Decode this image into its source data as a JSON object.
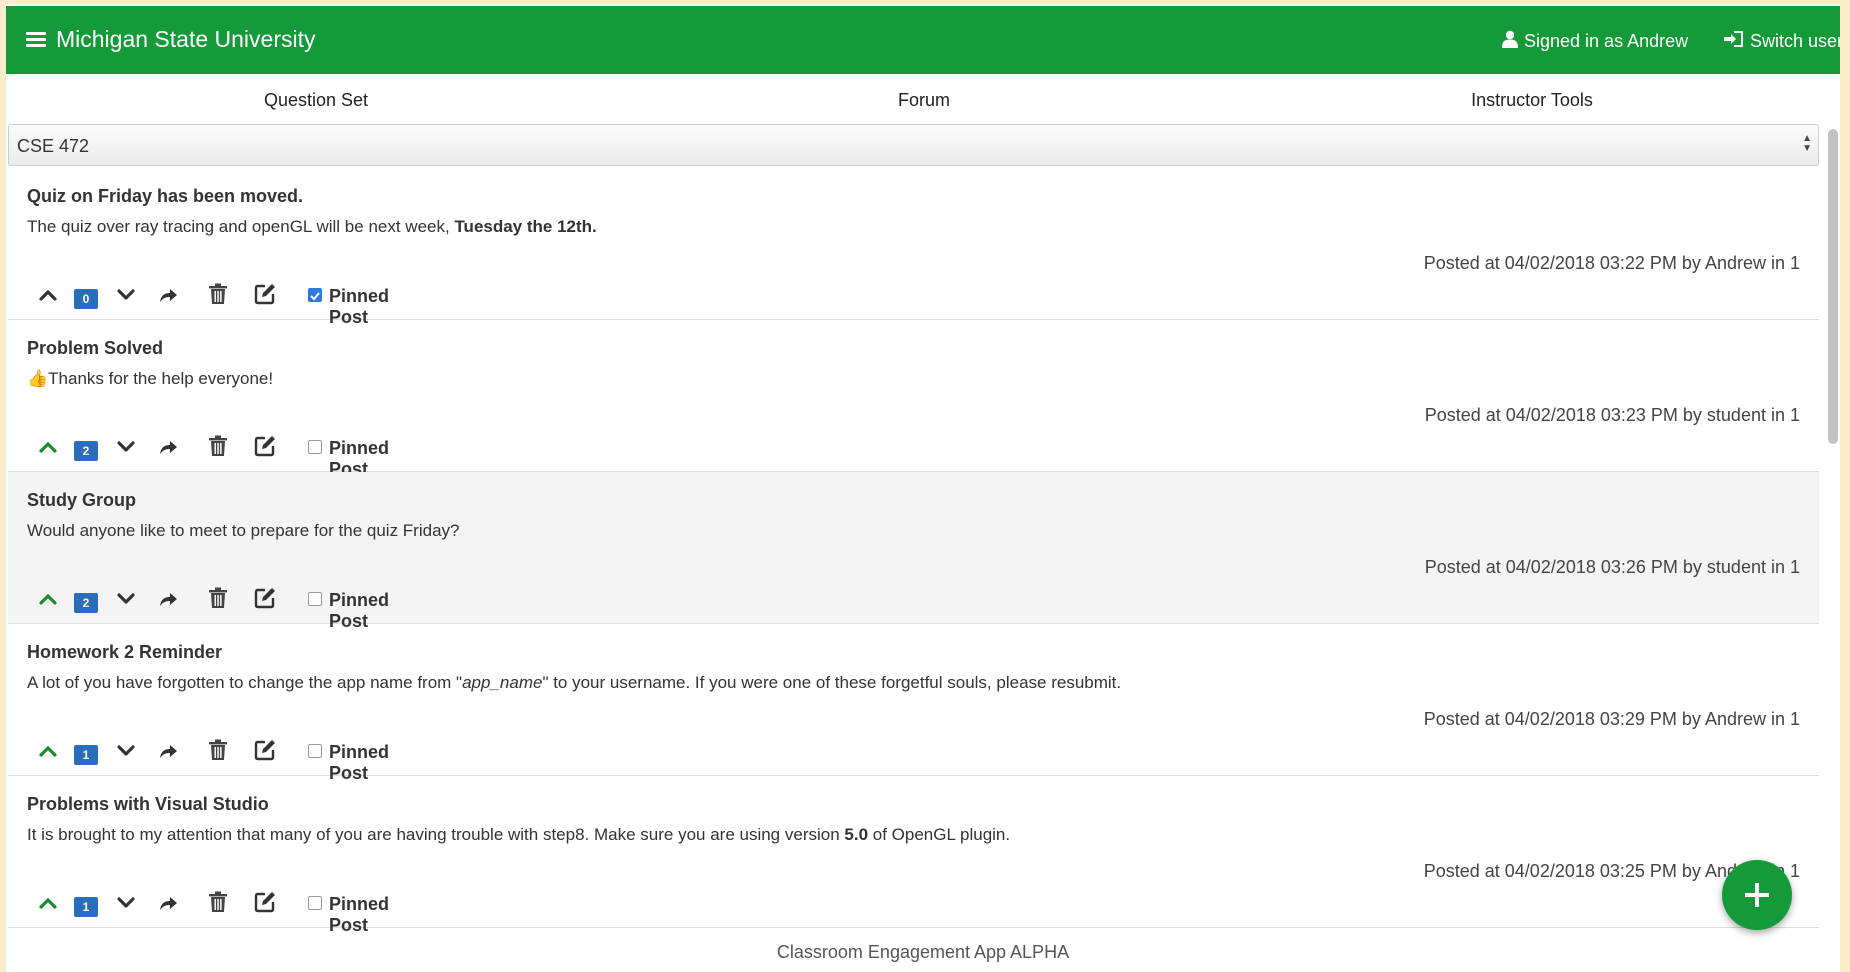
{
  "header": {
    "title": "Michigan State University",
    "signed_in": "Signed in as Andrew",
    "switch_user": "Switch user",
    "color": "#149a38"
  },
  "tabs": [
    "Question Set",
    "Forum",
    "Instructor Tools"
  ],
  "course_select": {
    "value": "CSE 472"
  },
  "posts": [
    {
      "title": "Quiz on Friday has been moved.",
      "body": "The quiz over ray tracing and openGL will be next week, ",
      "body_bold": "Tuesday the 12th.",
      "meta": "Posted at 04/02/2018 03:22 PM by Andrew in 1",
      "votes": "0",
      "pinned": true,
      "upvoted": false,
      "pin_label": "Pinned Post"
    },
    {
      "title": "Problem Solved",
      "emoji": "👍",
      "body": "Thanks for the help everyone!",
      "meta": "Posted at 04/02/2018 03:23 PM by student in 1",
      "votes": "2",
      "pinned": false,
      "upvoted": true,
      "pin_label": "Pinned Post"
    },
    {
      "title": "Study Group",
      "body": "Would anyone like to meet to prepare for the quiz Friday?",
      "meta": "Posted at 04/02/2018 03:26 PM by student in 1",
      "votes": "2",
      "pinned": false,
      "upvoted": true,
      "pin_label": "Pinned Post"
    },
    {
      "title": "Homework 2 Reminder",
      "body": "A lot of you have forgotten to change the app name from \"",
      "body_italic": "app_name",
      "body_after": "\" to your username. If you were one of these forgetful souls, please resubmit.",
      "meta": "Posted at 04/02/2018 03:29 PM by Andrew in 1",
      "votes": "1",
      "pinned": false,
      "upvoted": true,
      "pin_label": "Pinned Post"
    },
    {
      "title": "Problems with Visual Studio",
      "body": "It is brought to my attention that many of you are having trouble with step8. Make sure you are using version ",
      "body_bold": "5.0",
      "body_after": " of OpenGL plugin.",
      "meta": "Posted at 04/02/2018 03:25 PM by Andrew in 1",
      "votes": "1",
      "pinned": false,
      "upvoted": true,
      "pin_label": "Pinned Post"
    }
  ],
  "footer": "Classroom Engagement App ALPHA",
  "colors": {
    "upvote_active": "#1a8a2e",
    "neutral_icon": "#333333",
    "badge": "#2a6ebb"
  }
}
